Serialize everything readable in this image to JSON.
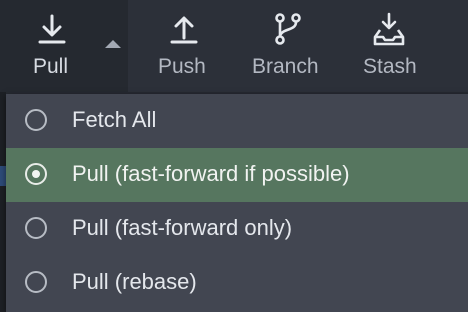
{
  "toolbar": {
    "pull": {
      "label": "Pull",
      "icon": "download-arrow-icon"
    },
    "push": {
      "label": "Push",
      "icon": "upload-arrow-icon"
    },
    "branch": {
      "label": "Branch",
      "icon": "git-branch-icon"
    },
    "stash": {
      "label": "Stash",
      "icon": "stash-tray-icon"
    }
  },
  "menu": {
    "items": [
      {
        "label": "Fetch All",
        "selected": false
      },
      {
        "label": "Pull (fast-forward if possible)",
        "selected": true
      },
      {
        "label": "Pull (fast-forward only)",
        "selected": false
      },
      {
        "label": "Pull (rebase)",
        "selected": false
      }
    ]
  },
  "colors": {
    "toolbar_bg": "#2c3039",
    "menu_bg": "#424651",
    "selected_bg": "#56765f",
    "text": "#e4e7ec"
  }
}
